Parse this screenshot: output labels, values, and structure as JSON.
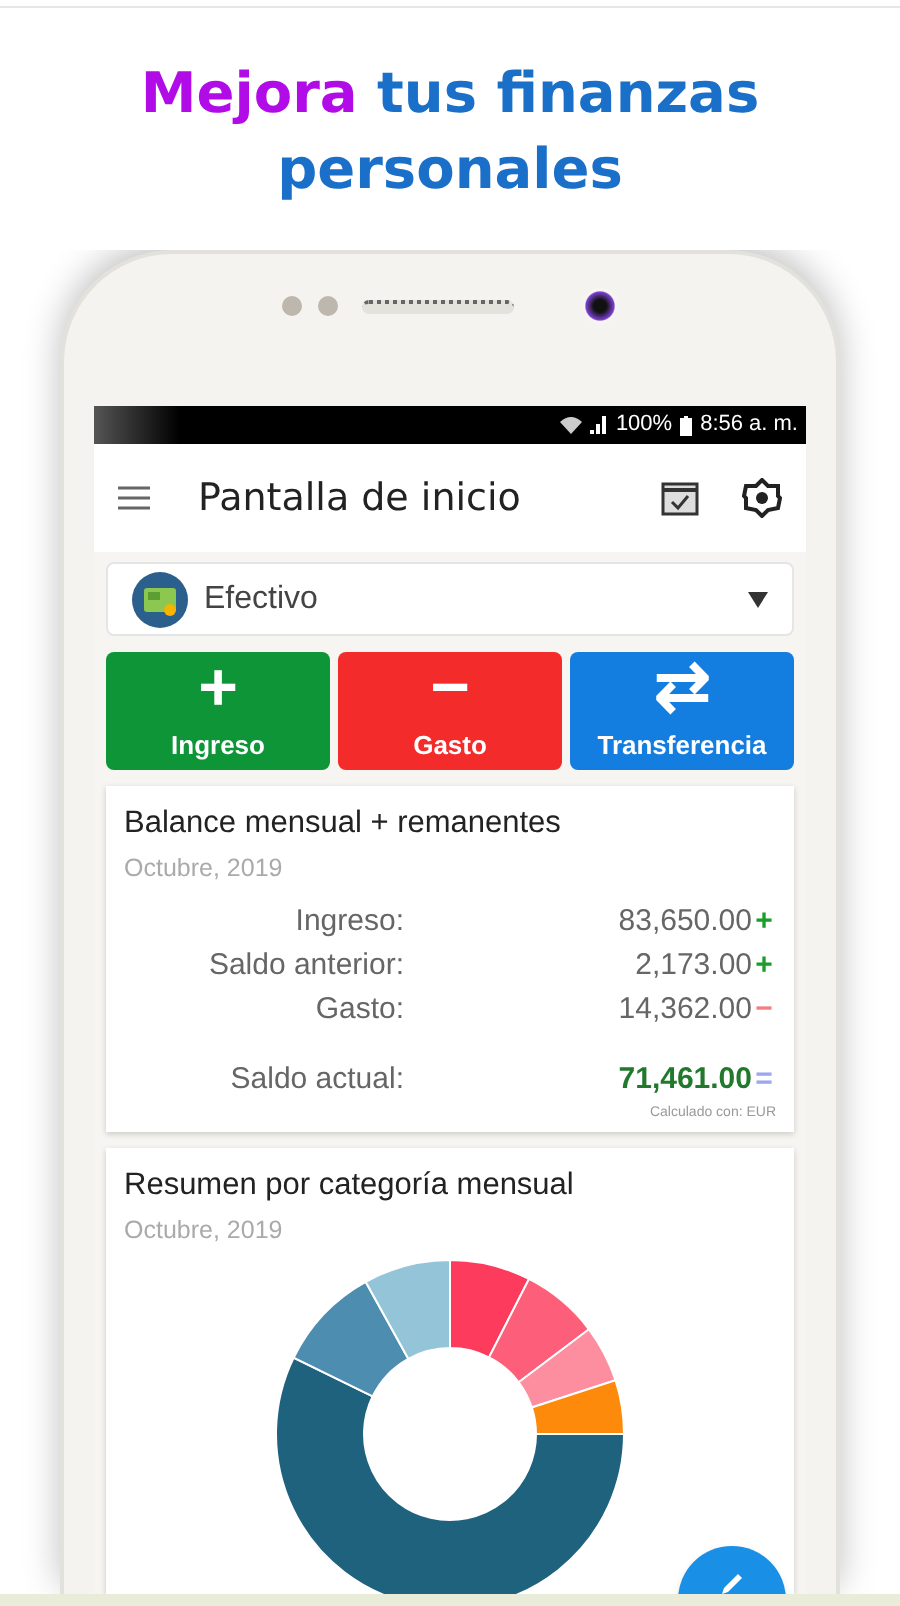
{
  "headline": {
    "highlight": "Mejora",
    "rest": "tus finanzas personales"
  },
  "status_bar": {
    "battery": "100%",
    "time": "8:56 a. m."
  },
  "app_bar": {
    "title": "Pantalla de inicio"
  },
  "account": {
    "name": "Efectivo"
  },
  "actions": [
    {
      "kind": "income",
      "icon": "+",
      "label": "Ingreso"
    },
    {
      "kind": "expense",
      "icon": "−",
      "label": "Gasto"
    },
    {
      "kind": "transfer",
      "icon": "⇄",
      "label": "Transferencia"
    }
  ],
  "balance": {
    "title": "Balance mensual + remanentes",
    "period": "Octubre, 2019",
    "rows": [
      {
        "kind": "plus",
        "label": "Ingreso:",
        "amount": "83,650.00",
        "sign": "+"
      },
      {
        "kind": "plus",
        "label": "Saldo anterior:",
        "amount": "2,173.00",
        "sign": "+"
      },
      {
        "kind": "minus",
        "label": "Gasto:",
        "amount": "14,362.00",
        "sign": "−"
      },
      {
        "kind": "total",
        "label": "Saldo actual:",
        "amount": "71,461.00",
        "sign": "="
      }
    ],
    "note": "Calculado con: EUR"
  },
  "category_summary": {
    "title": "Resumen por categoría mensual",
    "period": "Octubre, 2019"
  }
}
